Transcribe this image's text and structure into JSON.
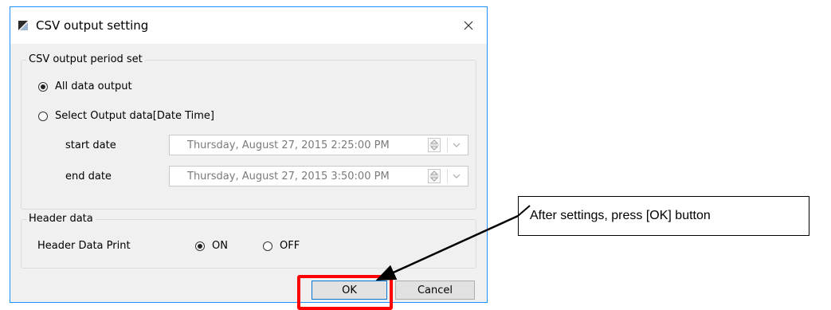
{
  "dialog": {
    "title": "CSV output setting",
    "icons": {
      "app": "app-icon",
      "close": "close-icon"
    }
  },
  "period_group": {
    "label": "CSV output period set",
    "options": [
      {
        "label": "All data output",
        "checked": true
      },
      {
        "label": "Select Output data[Date Time]",
        "checked": false
      }
    ],
    "start_label": "start date",
    "start_value": "Thursday, August 27, 2015 2:25:00 PM",
    "end_label": "end date",
    "end_value": "Thursday, August 27, 2015 3:50:00 PM"
  },
  "header_group": {
    "label": "Header data",
    "print_label": "Header Data Print",
    "on_label": "ON",
    "off_label": "OFF",
    "selected": "ON"
  },
  "buttons": {
    "ok": "OK",
    "cancel": "Cancel"
  },
  "annotation": {
    "text": "After settings, press [OK] button",
    "highlight_color": "#ff0000"
  }
}
